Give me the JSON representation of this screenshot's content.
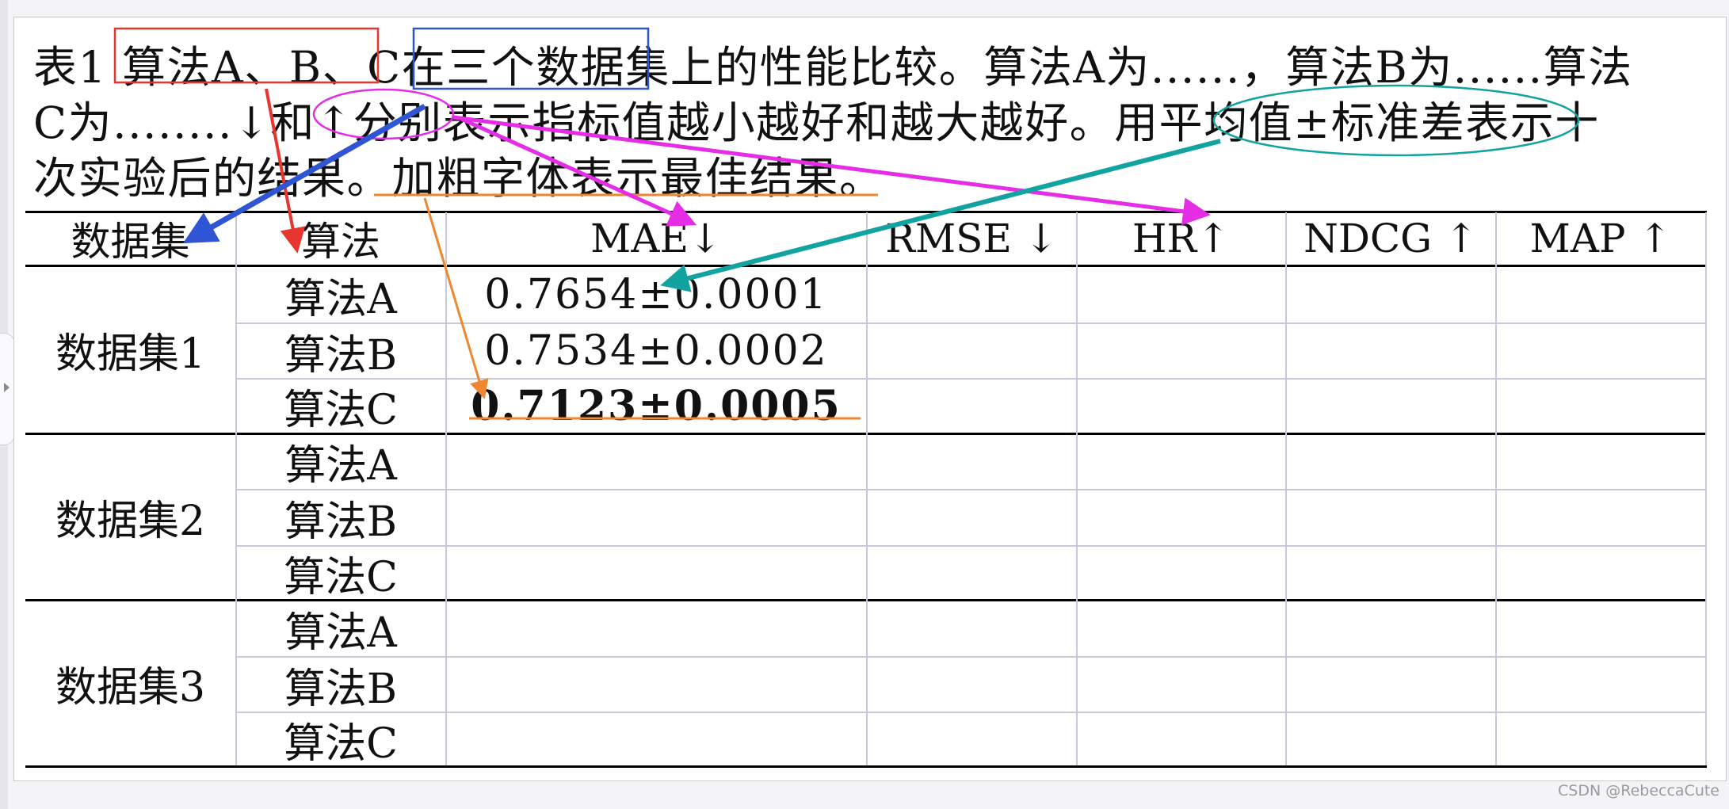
{
  "caption": {
    "line1": "表1 算法A、B、C在三个数据集上的性能比较。算法A为......，算法B为......算法",
    "line2": "C为........↓和↑分别表示指标值越小越好和越大越好。用平均值±标准差表示十",
    "line3": "次实验后的结果。加粗字体表示最佳结果。"
  },
  "table": {
    "headers": [
      "数据集",
      "算法",
      "MAE↓",
      "RMSE ↓",
      "HR↑",
      "NDCG ↑",
      "MAP ↑"
    ],
    "groups": [
      {
        "dataset": "数据集1",
        "rows": [
          {
            "algo": "算法A",
            "mae": "0.7654±0.0001"
          },
          {
            "algo": "算法B",
            "mae": "0.7534±0.0002"
          },
          {
            "algo": "算法C",
            "mae": "0.7123±0.0005"
          }
        ]
      },
      {
        "dataset": "数据集2",
        "rows": [
          {
            "algo": "算法A",
            "mae": ""
          },
          {
            "algo": "算法B",
            "mae": ""
          },
          {
            "algo": "算法C",
            "mae": ""
          }
        ]
      },
      {
        "dataset": "数据集3",
        "rows": [
          {
            "algo": "算法A",
            "mae": ""
          },
          {
            "algo": "算法B",
            "mae": ""
          },
          {
            "algo": "算法C",
            "mae": ""
          }
        ]
      }
    ]
  },
  "annotation_colors": {
    "red": "#e8352f",
    "blue": "#2f55d4",
    "magenta": "#e62de6",
    "teal": "#12a3a0",
    "orange": "#f0862e"
  },
  "watermark": "CSDN @RebeccaCute"
}
